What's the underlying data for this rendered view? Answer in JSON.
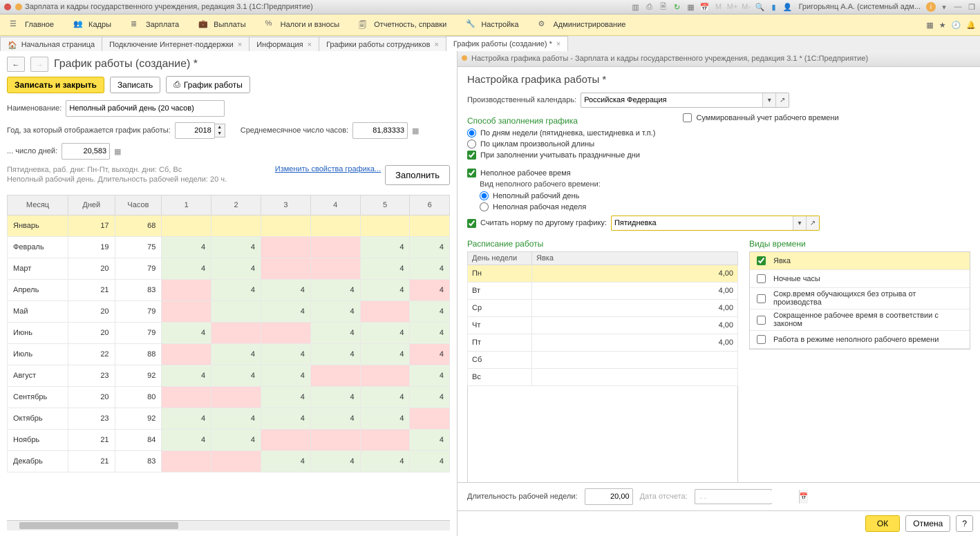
{
  "titlebar": {
    "app_title": "Зарплата и кадры государственного учреждения, редакция 3.1  (1С:Предприятие)",
    "user": "Григорьянц А.А. (системный адм..."
  },
  "menu": {
    "items": [
      {
        "label": "Главное"
      },
      {
        "label": "Кадры"
      },
      {
        "label": "Зарплата"
      },
      {
        "label": "Выплаты"
      },
      {
        "label": "Налоги и взносы"
      },
      {
        "label": "Отчетность, справки"
      },
      {
        "label": "Настройка"
      },
      {
        "label": "Администрирование"
      }
    ]
  },
  "tabs": {
    "items": [
      {
        "label": "Начальная страница",
        "closable": false,
        "home": true
      },
      {
        "label": "Подключение Интернет-поддержки",
        "closable": true
      },
      {
        "label": "Информация",
        "closable": true
      },
      {
        "label": "Графики работы сотрудников",
        "closable": true
      },
      {
        "label": "График работы (создание) *",
        "closable": true,
        "active": true
      }
    ]
  },
  "left": {
    "title": "График работы (создание) *",
    "toolbar": {
      "save_close": "Записать и закрыть",
      "save": "Записать",
      "print": "График работы"
    },
    "name_label": "Наименование:",
    "name_value": "Неполный рабочий день (20 часов)",
    "year_label": "Год, за который отображается график работы:",
    "year_value": "2018",
    "avg_hours_label": "Среднемесячное число часов:",
    "avg_hours_value": "81,83333",
    "days_label": "... число дней:",
    "days_value": "20,583",
    "hint1": "Пятидневка, раб. дни: Пн-Пт, выходн. дни: Сб, Вс",
    "hint2": "Неполный рабочий день. Длительность рабочей недели: 20 ч.",
    "change_props": "Изменить свойства графика...",
    "fill": "Заполнить",
    "cols": {
      "month": "Месяц",
      "days": "Дней",
      "hours": "Часов",
      "c1": "1",
      "c2": "2",
      "c3": "3",
      "c4": "4",
      "c5": "5",
      "c6": "6"
    },
    "rows": [
      {
        "month": "Январь",
        "days": "17",
        "hours": "68",
        "v": [
          "",
          "",
          "",
          "",
          "",
          ""
        ],
        "sel": true,
        "pink": []
      },
      {
        "month": "Февраль",
        "days": "19",
        "hours": "75",
        "v": [
          "4",
          "4",
          "",
          "",
          "4",
          "4"
        ],
        "pink": [
          2,
          3
        ]
      },
      {
        "month": "Март",
        "days": "20",
        "hours": "79",
        "v": [
          "4",
          "4",
          "",
          "",
          "4",
          "4"
        ],
        "pink": [
          2,
          3
        ]
      },
      {
        "month": "Апрель",
        "days": "21",
        "hours": "83",
        "v": [
          "",
          "4",
          "4",
          "4",
          "4",
          "4"
        ],
        "pink": [
          0,
          5
        ]
      },
      {
        "month": "Май",
        "days": "20",
        "hours": "79",
        "v": [
          "",
          "",
          "4",
          "4",
          "",
          "4"
        ],
        "pink": [
          0,
          4
        ]
      },
      {
        "month": "Июнь",
        "days": "20",
        "hours": "79",
        "v": [
          "4",
          "",
          "",
          "4",
          "4",
          "4"
        ],
        "pink": [
          1,
          2
        ]
      },
      {
        "month": "Июль",
        "days": "22",
        "hours": "88",
        "v": [
          "",
          "4",
          "4",
          "4",
          "4",
          "4"
        ],
        "pink": [
          0,
          5
        ]
      },
      {
        "month": "Август",
        "days": "23",
        "hours": "92",
        "v": [
          "4",
          "4",
          "4",
          "",
          "",
          "4"
        ],
        "pink": [
          3,
          4
        ]
      },
      {
        "month": "Сентябрь",
        "days": "20",
        "hours": "80",
        "v": [
          "",
          "",
          "4",
          "4",
          "4",
          "4"
        ],
        "pink": [
          0,
          1
        ]
      },
      {
        "month": "Октябрь",
        "days": "23",
        "hours": "92",
        "v": [
          "4",
          "4",
          "4",
          "4",
          "4",
          ""
        ],
        "pink": [
          5
        ]
      },
      {
        "month": "Ноябрь",
        "days": "21",
        "hours": "84",
        "v": [
          "4",
          "4",
          "",
          "",
          "",
          "4"
        ],
        "pink": [
          2,
          3,
          4
        ]
      },
      {
        "month": "Декабрь",
        "days": "21",
        "hours": "83",
        "v": [
          "",
          "",
          "4",
          "4",
          "4",
          "4"
        ],
        "pink": [
          0,
          1
        ]
      }
    ]
  },
  "right": {
    "window_title": "Настройка графика работы - Зарплата и кадры государственного учреждения, редакция 3.1 *  (1С:Предприятие)",
    "heading": "Настройка графика работы *",
    "calendar_label": "Производственный календарь:",
    "calendar_value": "Российская Федерация",
    "section_fill": "Способ заполнения графика",
    "summed_label": "Суммированный учет рабочего времени",
    "r_weekdays": "По дням недели (пятидневка, шестидневка и т.п.)",
    "r_cycles": "По циклам произвольной длины",
    "chk_holidays": "При заполнении учитывать праздничные дни",
    "chk_parttime": "Неполное рабочее время",
    "parttime_kind_label": "Вид неполного рабочего времени:",
    "r_partday": "Неполный рабочий день",
    "r_partweek": "Неполная рабочая неделя",
    "chk_norm": "Считать норму по другому графику:",
    "norm_value": "Пятидневка",
    "section_schedule": "Расписание работы",
    "section_types": "Виды времени",
    "sched_cols": {
      "dow": "День недели",
      "att": "Явка"
    },
    "sched_rows": [
      {
        "d": "Пн",
        "v": "4,00",
        "sel": true
      },
      {
        "d": "Вт",
        "v": "4,00"
      },
      {
        "d": "Ср",
        "v": "4,00"
      },
      {
        "d": "Чт",
        "v": "4,00"
      },
      {
        "d": "Пт",
        "v": "4,00"
      },
      {
        "d": "Сб",
        "v": ""
      },
      {
        "d": "Вс",
        "v": ""
      }
    ],
    "types": [
      {
        "label": "Явка",
        "checked": true,
        "sel": true
      },
      {
        "label": "Ночные часы"
      },
      {
        "label": "Сокр.время обучающихся без отрыва от производства"
      },
      {
        "label": "Сокращенное рабочее время в соответствии с законом"
      },
      {
        "label": "Работа в режиме неполного рабочего времени"
      }
    ],
    "week_dur_label": "Длительность рабочей недели:",
    "week_dur_value": "20,00",
    "date_label": "Дата отсчета:",
    "date_value": " . . ",
    "ok": "ОК",
    "cancel": "Отмена",
    "help": "?"
  }
}
